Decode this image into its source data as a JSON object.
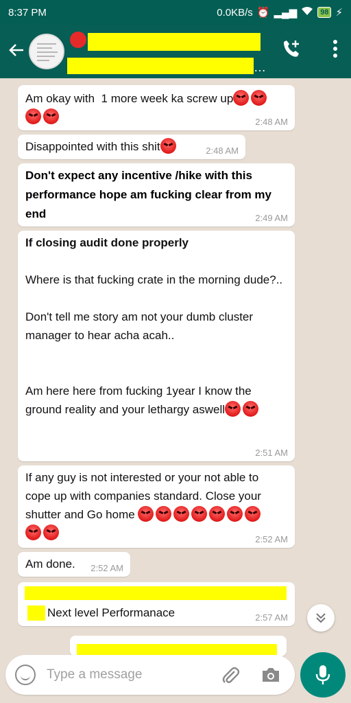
{
  "status_bar": {
    "time": "8:37 PM",
    "net_speed": "0.0KB/s",
    "battery": "98"
  },
  "header": {
    "icons": [
      "back-arrow-icon",
      "video-call-icon",
      "more-options-icon"
    ]
  },
  "messages": [
    {
      "text": "Am okay with  1 more week ka screw up",
      "emojis_inline": 2,
      "emojis_next_line": 2,
      "time": "2:48 AM"
    },
    {
      "text": "Disappointed with this shit",
      "emojis_inline": 1,
      "time": "2:48 AM"
    },
    {
      "text": "Don't expect any incentive /hike with this performance hope am fucking clear from my end",
      "time": "2:49 AM"
    },
    {
      "text_lines": [
        "If closing audit done properly",
        "",
        "Where is that fucking crate in the morning dude?..",
        "",
        "Don't tell me story am not your dumb cluster manager to hear acha acah..",
        "",
        "",
        "Am here here from fucking 1year I know the ground reality and your lethargy aswell"
      ],
      "emojis_end": 2,
      "time": "2:51 AM"
    },
    {
      "text": "If any guy is not interested or your not able to cope up with companies standard. Close your shutter and Go home",
      "emojis_inline": 7,
      "emojis_next_line": 2,
      "time": "2:52 AM"
    },
    {
      "text": "Am done.",
      "time": "2:52 AM"
    },
    {
      "text": "Next level Performanace",
      "time": "2:57 AM"
    }
  ],
  "input": {
    "placeholder": "Type a message"
  },
  "colors": {
    "header": "#075e54",
    "status_bar": "#045e54",
    "chat_bg": "#e7ddd3",
    "highlight": "#ffff00",
    "mic": "#00897b"
  }
}
